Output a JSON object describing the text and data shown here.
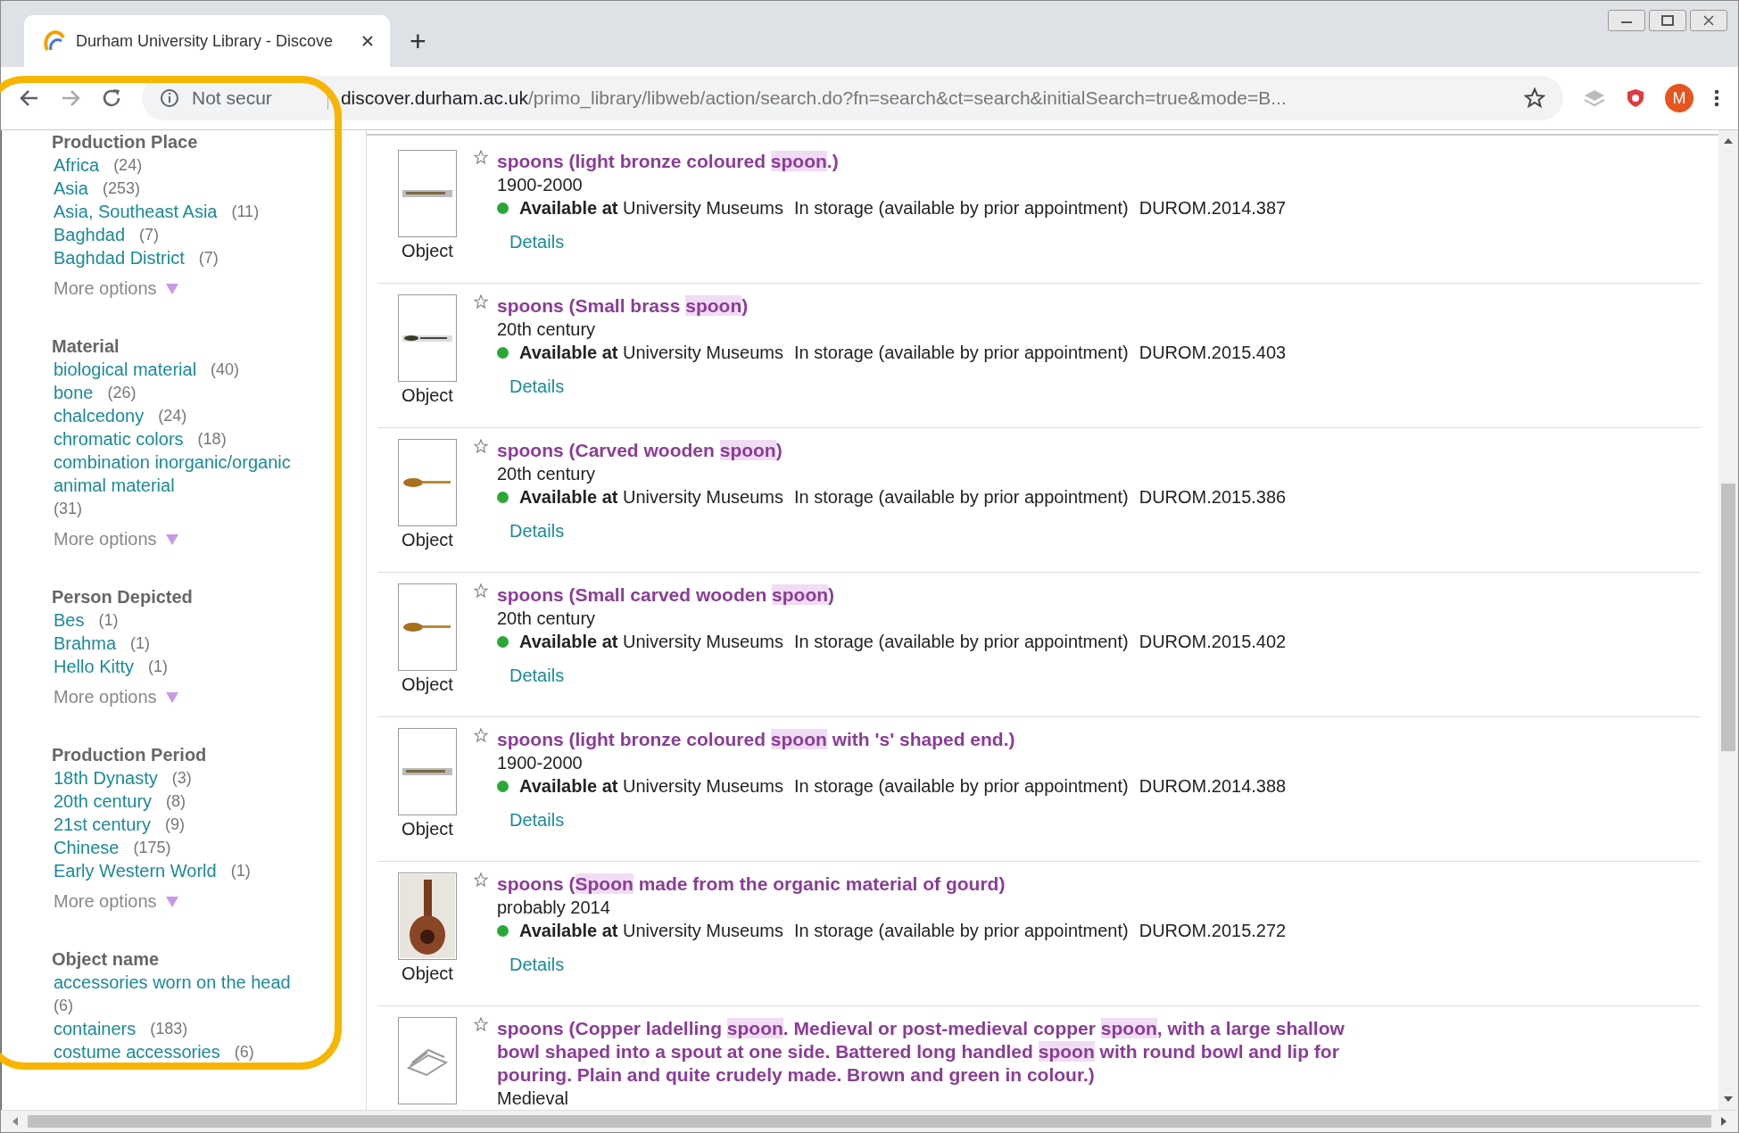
{
  "browser": {
    "tab_title": "Durham University Library - Discove",
    "new_tab": "+",
    "security": "Not secur",
    "url_host": "discover.durham.ac.uk",
    "url_path": "/primo_library/libweb/action/search.do?fn=search&ct=search&initialSearch=true&mode=B...",
    "avatar": "M"
  },
  "facets": [
    {
      "heading": "Production Place",
      "options": [
        {
          "label": "Africa",
          "count": "(24)"
        },
        {
          "label": "Asia",
          "count": "(253)"
        },
        {
          "label": "Asia, Southeast Asia",
          "count": "(11)"
        },
        {
          "label": "Baghdad",
          "count": "(7)"
        },
        {
          "label": "Baghdad District",
          "count": "(7)"
        }
      ],
      "more": "More options"
    },
    {
      "heading": "Material",
      "options": [
        {
          "label": "biological material",
          "count": "(40)"
        },
        {
          "label": "bone",
          "count": "(26)"
        },
        {
          "label": "chalcedony",
          "count": "(24)"
        },
        {
          "label": "chromatic colors",
          "count": "(18)"
        },
        {
          "label": "combination inorganic/organic animal material",
          "count": "(31)"
        }
      ],
      "more": "More options"
    },
    {
      "heading": "Person Depicted",
      "options": [
        {
          "label": "Bes",
          "count": "(1)"
        },
        {
          "label": "Brahma",
          "count": "(1)"
        },
        {
          "label": "Hello Kitty",
          "count": "(1)"
        }
      ],
      "more": "More options"
    },
    {
      "heading": "Production Period",
      "options": [
        {
          "label": "18th Dynasty",
          "count": "(3)"
        },
        {
          "label": "20th century",
          "count": "(8)"
        },
        {
          "label": "21st century",
          "count": "(9)"
        },
        {
          "label": "Chinese",
          "count": "(175)"
        },
        {
          "label": "Early Western World",
          "count": "(1)"
        }
      ],
      "more": "More options"
    },
    {
      "heading": "Object name",
      "options": [
        {
          "label": "accessories worn on the head",
          "count": "(6)"
        },
        {
          "label": "containers",
          "count": "(183)"
        },
        {
          "label": "costume accessories",
          "count": "(6)"
        }
      ]
    }
  ],
  "results": [
    {
      "kind": "bronze-spoon",
      "type": "Object",
      "title": [
        {
          "text": "spoons (light bronze coloured ",
          "highlight": false
        },
        {
          "text": "spoon",
          "highlight": true
        },
        {
          "text": ".)",
          "highlight": false
        }
      ],
      "date": "1900-2000",
      "availability": {
        "status": "Available at",
        "location": "University Museums",
        "shelf": "In storage (available by prior appointment)",
        "id": "DUROM.2014.387"
      },
      "details": "Details"
    },
    {
      "kind": "brass-spoon",
      "type": "Object",
      "title": [
        {
          "text": "spoons (Small brass ",
          "highlight": false
        },
        {
          "text": "spoon",
          "highlight": true
        },
        {
          "text": ")",
          "highlight": false
        }
      ],
      "date": "20th century",
      "availability": {
        "status": "Available at",
        "location": "University Museums",
        "shelf": "In storage (available by prior appointment)",
        "id": "DUROM.2015.403"
      },
      "details": "Details"
    },
    {
      "kind": "wooden-spoon",
      "type": "Object",
      "title": [
        {
          "text": "spoons (Carved wooden ",
          "highlight": false
        },
        {
          "text": "spoon",
          "highlight": true
        },
        {
          "text": ")",
          "highlight": false
        }
      ],
      "date": "20th century",
      "availability": {
        "status": "Available at",
        "location": "University Museums",
        "shelf": "In storage (available by prior appointment)",
        "id": "DUROM.2015.386"
      },
      "details": "Details"
    },
    {
      "kind": "wooden-spoon",
      "type": "Object",
      "title": [
        {
          "text": "spoons (Small carved wooden ",
          "highlight": false
        },
        {
          "text": "spoon",
          "highlight": true
        },
        {
          "text": ")",
          "highlight": false
        }
      ],
      "date": "20th century",
      "availability": {
        "status": "Available at",
        "location": "University Museums",
        "shelf": "In storage (available by prior appointment)",
        "id": "DUROM.2015.402"
      },
      "details": "Details"
    },
    {
      "kind": "bronze-spoon",
      "type": "Object",
      "title": [
        {
          "text": "spoons (light bronze coloured ",
          "highlight": false
        },
        {
          "text": "spoon",
          "highlight": true
        },
        {
          "text": " with 's' shaped end.)",
          "highlight": false
        }
      ],
      "date": "1900-2000",
      "availability": {
        "status": "Available at",
        "location": "University Museums",
        "shelf": "In storage (available by prior appointment)",
        "id": "DUROM.2014.388"
      },
      "details": "Details"
    },
    {
      "kind": "gourd",
      "type": "Object",
      "title": [
        {
          "text": "spoons (",
          "highlight": false
        },
        {
          "text": "Spoon",
          "highlight": true
        },
        {
          "text": " made from the organic material of gourd)",
          "highlight": false
        }
      ],
      "date": "probably 2014",
      "availability": {
        "status": "Available at",
        "location": "University Museums",
        "shelf": "In storage (available by prior appointment)",
        "id": "DUROM.2015.272"
      },
      "details": "Details"
    },
    {
      "kind": "book",
      "title": [
        {
          "text": "spoons (Copper ladelling ",
          "highlight": false
        },
        {
          "text": "spoon",
          "highlight": true
        },
        {
          "text": ". Medieval or post-medieval copper ",
          "highlight": false
        },
        {
          "text": "spoon",
          "highlight": true
        },
        {
          "text": ", with a large shallow bowl shaped into a spout at one side. Battered long handled ",
          "highlight": false
        },
        {
          "text": "spoon",
          "highlight": true
        },
        {
          "text": " with round bowl and lip for pouring. Plain and quite crudely made. Brown and green in colour.)",
          "highlight": false
        }
      ],
      "date": "Medieval"
    }
  ]
}
